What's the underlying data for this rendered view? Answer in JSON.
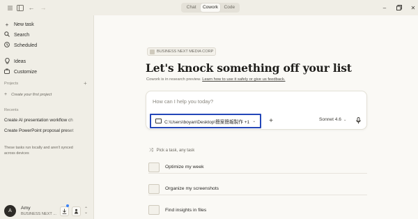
{
  "titlebar": {
    "modes": [
      "Chat",
      "Cowork",
      "Code"
    ],
    "active_mode": "Cowork"
  },
  "sidebar": {
    "nav": [
      {
        "label": "New task",
        "icon": "plus-icon"
      },
      {
        "label": "Search",
        "icon": "search-icon"
      },
      {
        "label": "Scheduled",
        "icon": "clock-icon"
      },
      {
        "label": "Ideas",
        "icon": "lightbulb-icon"
      },
      {
        "label": "Customize",
        "icon": "briefcase-icon"
      }
    ],
    "projects_label": "Projects",
    "create_project_label": "Create your first project",
    "recents_label": "Recents",
    "recents": [
      "Create AI presentation workflow ch",
      "Create PowerPoint proposal preset"
    ],
    "local_note": "These tasks run locally and aren't synced across devices",
    "user": {
      "initial": "A",
      "name": "Amy",
      "org": "BUSINESS NEXT ..."
    }
  },
  "main": {
    "org_badge": "BUSINESS NEXT MEDIA CORP",
    "headline": "Let's knock something off your list",
    "subline_prefix": "Cowork is in research preview. ",
    "subline_link": "Learn how to use it safely or give us feedback.",
    "prompt": {
      "placeholder": "How can I help you today?",
      "folder": "C:\\Users\\boyan\\Desktop\\簡案簡報製作 +1",
      "model": "Sonnet 4.6"
    },
    "pick_label": "Pick a task, any task",
    "tasks": [
      "Optimize my week",
      "Organize my screenshots",
      "Find insights in files"
    ]
  },
  "colors": {
    "background": "#faf9f5",
    "sidebar": "#f0eee6",
    "highlight_border": "#2346b8",
    "notification_dot": "#3b82f6"
  }
}
